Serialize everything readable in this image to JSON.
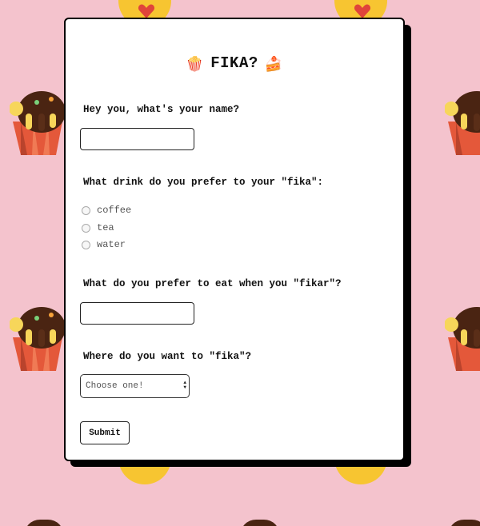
{
  "form": {
    "title": "FIKA?",
    "title_emoji_left": "🍿",
    "title_emoji_right": "🍰",
    "q_name": "Hey you, what's your name?",
    "q_drink": "What drink do you prefer to your \"fika\":",
    "drink_options": [
      "coffee",
      "tea",
      "water"
    ],
    "q_eat": "What do you prefer to eat when you \"fikar\"?",
    "q_where": "Where do you want to \"fika\"?",
    "select_placeholder": "Choose one!",
    "submit_label": "Submit"
  },
  "colors": {
    "background": "#f4c3cd",
    "card": "#ffffff",
    "shadow": "#000000",
    "emoji_yellow": "#f7c531",
    "heart_red": "#e0443a"
  },
  "decor_icons": [
    "heart-eyes-emoji-icon",
    "cupcake-icon",
    "smile-emoji-icon"
  ]
}
